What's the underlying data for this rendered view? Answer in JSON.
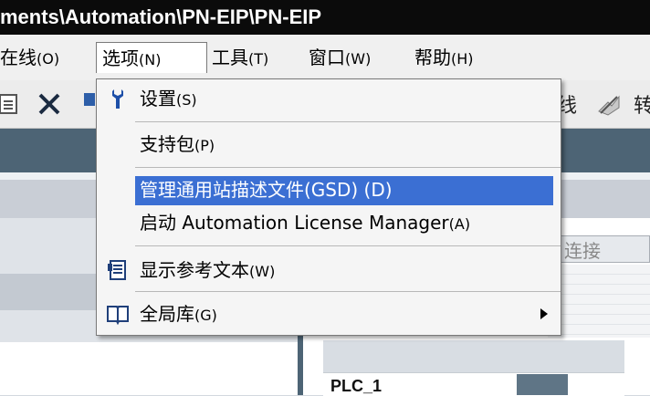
{
  "title": "ments\\Automation\\PN-EIP\\PN-EIP",
  "menubar": {
    "items": [
      {
        "label": "在线",
        "acc": "(O)"
      },
      {
        "label": "选项",
        "acc": "(N)"
      },
      {
        "label": "工具",
        "acc": "(T)"
      },
      {
        "label": "窗口",
        "acc": "(W)"
      },
      {
        "label": "帮助",
        "acc": "(H)"
      }
    ]
  },
  "toolbar": {
    "right_text": "线",
    "right_text2": "转"
  },
  "options_menu": {
    "items": [
      {
        "label": "设置",
        "acc": "(S)",
        "icon": "settings-wrench-icon"
      },
      {
        "label": "支持包",
        "acc": "(P)"
      },
      {
        "label": "管理通用站描述文件(GSD) (D)",
        "highlighted": true
      },
      {
        "label": "启动 Automation License Manager",
        "acc": "(A)"
      },
      {
        "label": "显示参考文本",
        "acc": "(W)",
        "icon": "reference-text-icon"
      },
      {
        "label": "全局库",
        "acc": "(G)",
        "icon": "book-icon",
        "submenu": true
      }
    ]
  },
  "right_pane": {
    "tab_label": "连接",
    "device_label": "PLC_1"
  },
  "colors": {
    "highlight": "#3b6fd3",
    "band": "#4d6475",
    "titlebar": "#0b0b0b"
  }
}
